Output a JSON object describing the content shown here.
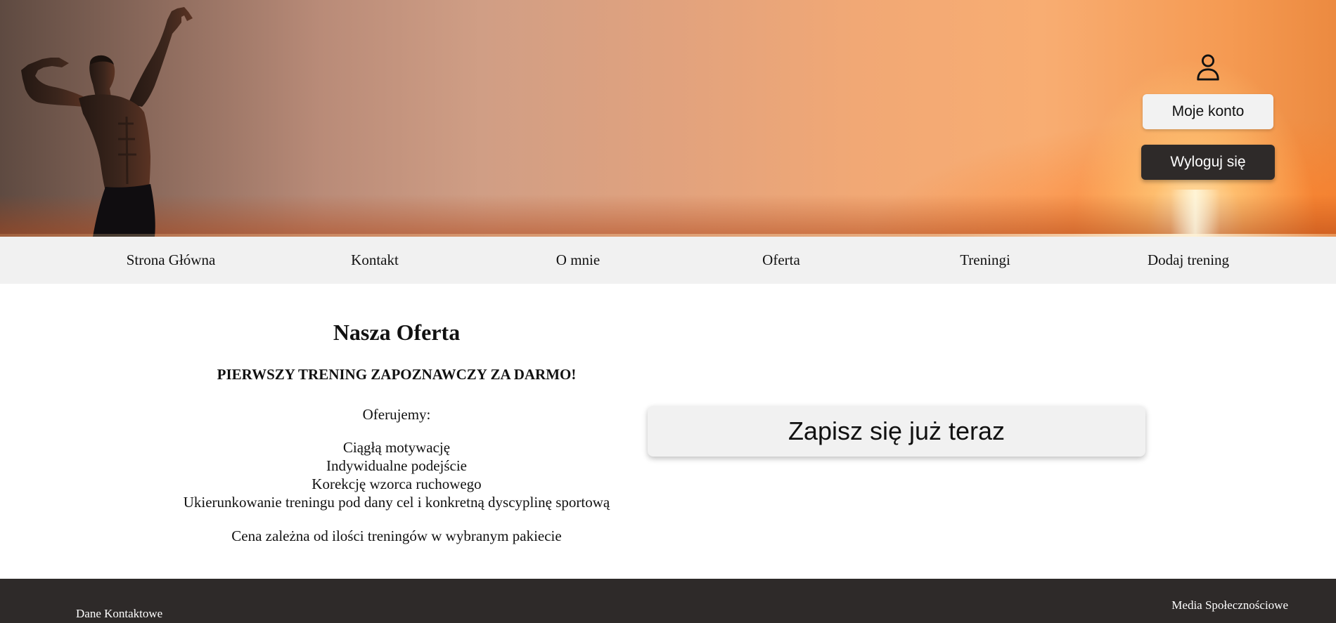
{
  "header": {
    "account_button": "Moje konto",
    "logout_button": "Wyloguj się"
  },
  "nav": {
    "items": [
      "Strona Główna",
      "Kontakt",
      "O mnie",
      "Oferta",
      "Treningi",
      "Dodaj trening"
    ]
  },
  "offer": {
    "title": "Nasza Oferta",
    "promo": "PIERWSZY TRENING ZAPOZNAWCZY ZA DARMO!",
    "intro": "Oferujemy:",
    "features": [
      "Ciągłą motywację",
      "Indywidualne podejście",
      "Korekcję wzorca ruchowego",
      "Ukierunkowanie treningu pod dany cel i konkretną dyscyplinę sportową"
    ],
    "price_note": "Cena zależna od ilości treningów w wybranym pakiecie",
    "signup_button": "Zapisz się już teraz"
  },
  "footer": {
    "contact_heading": "Dane Kontaktowe",
    "social_heading": "Media Społecznościowe"
  },
  "icons": {
    "account": "user-icon"
  },
  "colors": {
    "nav_background": "#f1f1f1",
    "dark_button": "#2e2a29",
    "footer_background": "#2e2a29"
  }
}
